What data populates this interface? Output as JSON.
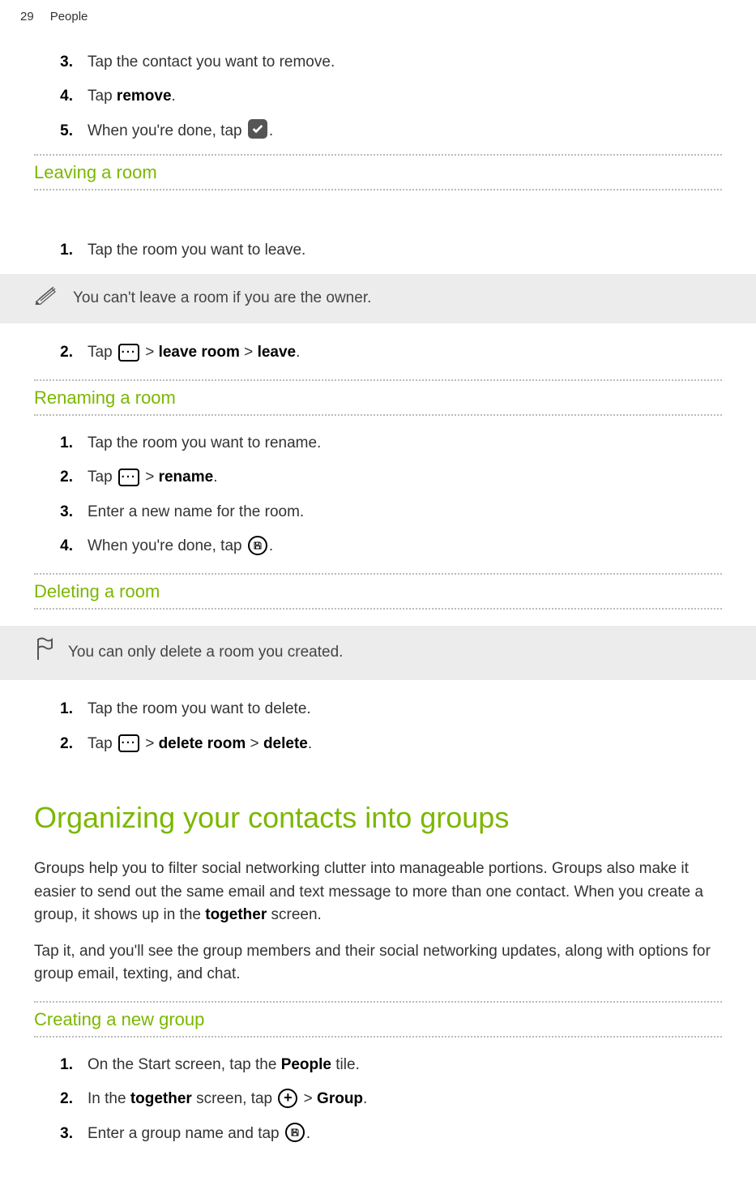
{
  "header": {
    "page_number": "29",
    "section": "People"
  },
  "remove_steps": {
    "s3_num": "3.",
    "s3_text_a": "Tap the contact you want to remove.",
    "s4_num": "4.",
    "s4_text_a": "Tap ",
    "s4_bold": "remove",
    "s4_text_b": ".",
    "s5_num": "5.",
    "s5_text_a": "When you're done, tap ",
    "s5_text_b": "."
  },
  "leaving": {
    "heading": "Leaving a room",
    "s1_num": "1.",
    "s1_text": "Tap the room you want to leave.",
    "note": "You can't leave a room if you are the owner.",
    "s2_num": "2.",
    "s2_a": "Tap ",
    "s2_b": " > ",
    "s2_bold1": "leave room",
    "s2_c": " > ",
    "s2_bold2": "leave",
    "s2_d": "."
  },
  "renaming": {
    "heading": "Renaming a room",
    "s1_num": "1.",
    "s1_text": "Tap the room you want to rename.",
    "s2_num": "2.",
    "s2_a": "Tap ",
    "s2_b": " > ",
    "s2_bold": "rename",
    "s2_c": ".",
    "s3_num": "3.",
    "s3_text": "Enter a new name for the room.",
    "s4_num": "4.",
    "s4_a": "When you're done, tap ",
    "s4_b": "."
  },
  "deleting": {
    "heading": "Deleting a room",
    "note": "You can only delete a room you created.",
    "s1_num": "1.",
    "s1_text": "Tap the room you want to delete.",
    "s2_num": "2.",
    "s2_a": "Tap ",
    "s2_b": " > ",
    "s2_bold1": "delete room",
    "s2_c": " > ",
    "s2_bold2": "delete",
    "s2_d": "."
  },
  "organizing": {
    "heading": "Organizing your contacts into groups",
    "p1_a": "Groups help you to filter social networking clutter into manageable portions. Groups also make it easier to send out the same email and text message to more than one contact. When you create a group, it shows up in the ",
    "p1_bold": "together",
    "p1_b": " screen.",
    "p2": "Tap it, and you'll see the group members and their social networking updates, along with options for group email, texting, and chat."
  },
  "creating": {
    "heading": "Creating a new group",
    "s1_num": "1.",
    "s1_a": "On the Start screen, tap the ",
    "s1_bold": "People",
    "s1_b": " tile.",
    "s2_num": "2.",
    "s2_a": "In the ",
    "s2_bold1": "together",
    "s2_b": " screen, tap ",
    "s2_c": " > ",
    "s2_bold2": "Group",
    "s2_d": ".",
    "s3_num": "3.",
    "s3_a": "Enter a group name and tap ",
    "s3_b": "."
  }
}
